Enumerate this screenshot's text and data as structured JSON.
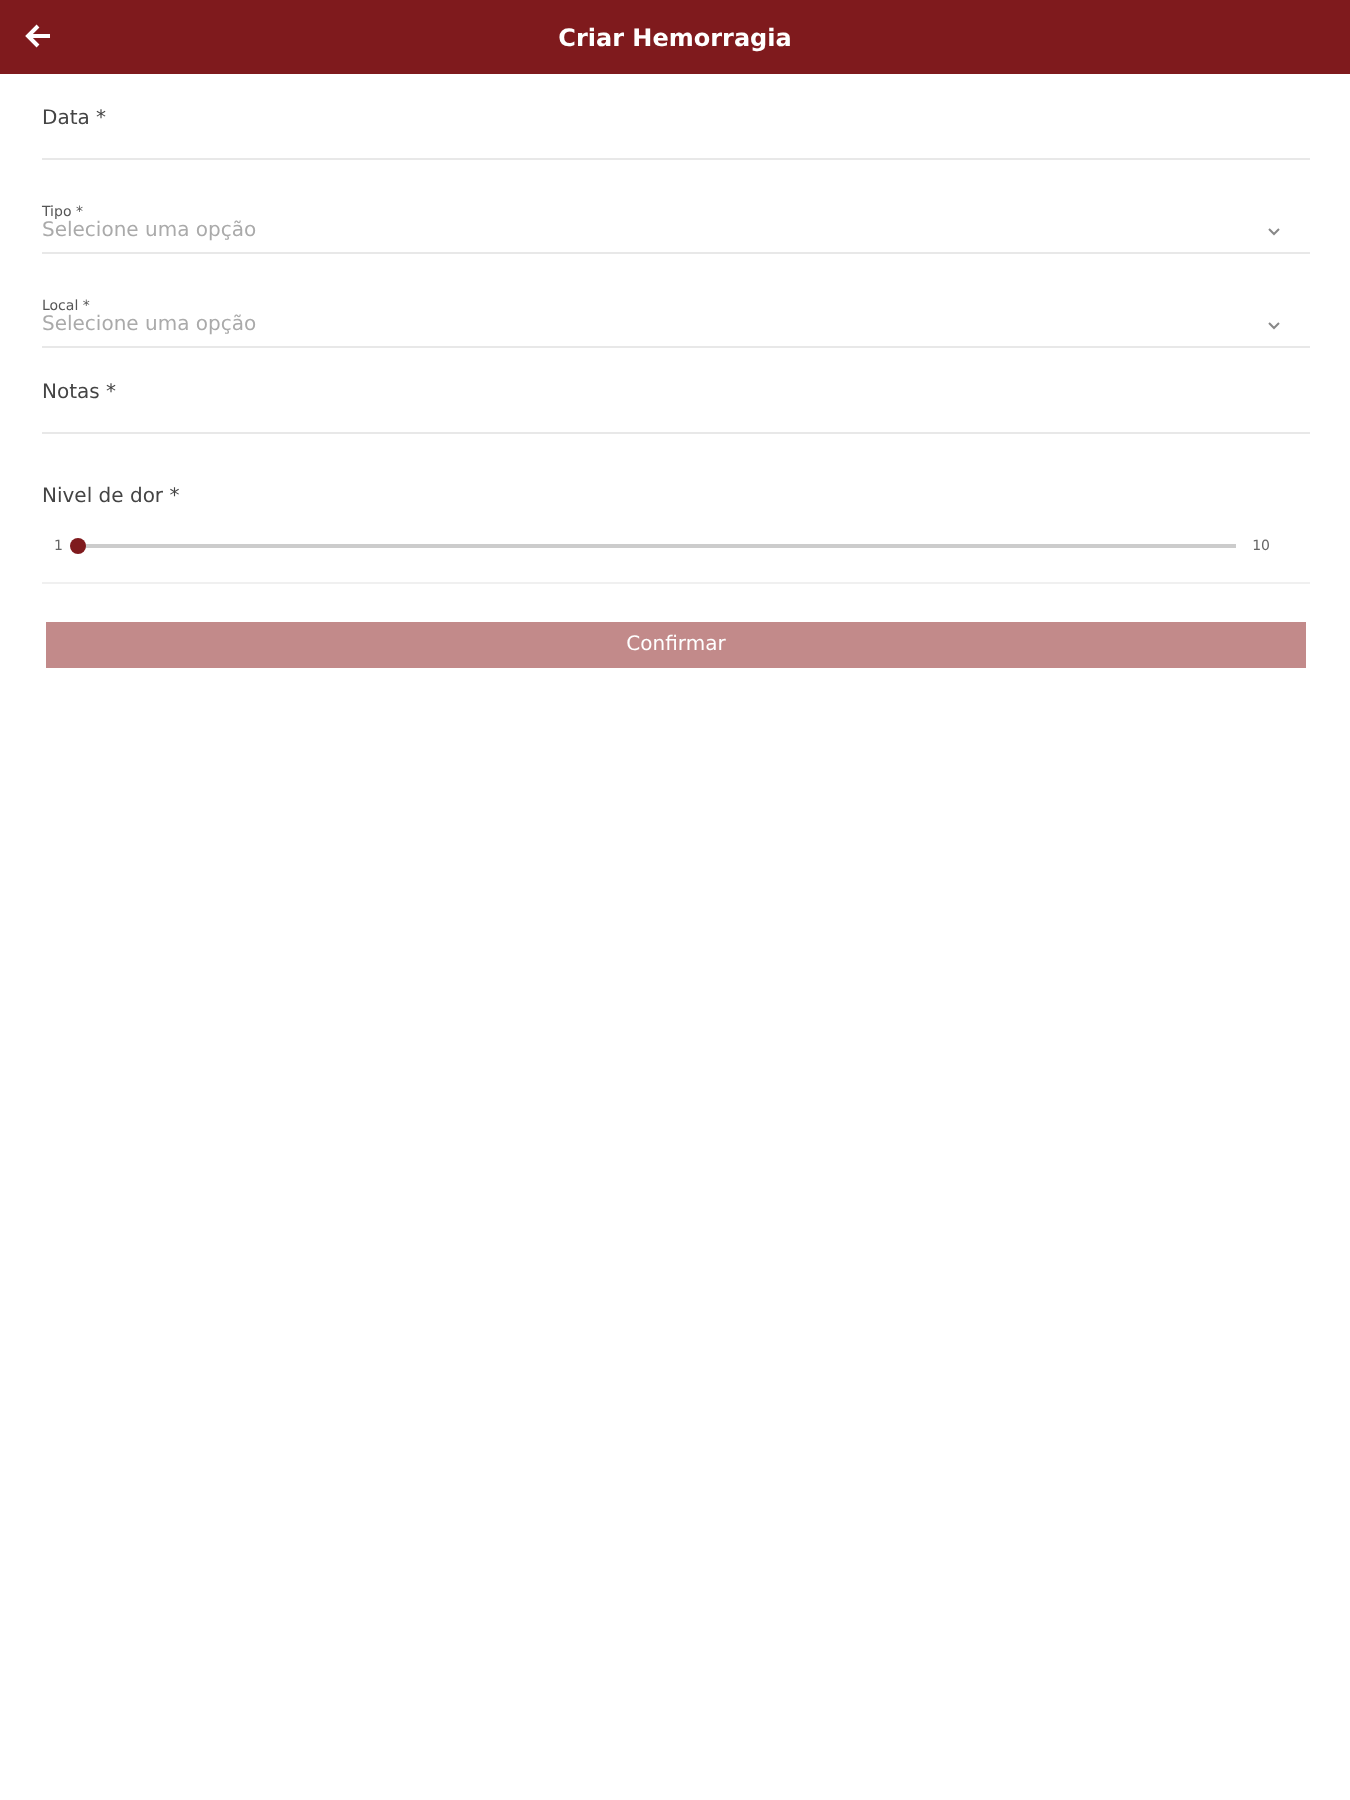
{
  "header": {
    "title": "Criar Hemorragia"
  },
  "fields": [
    {
      "kind": "text",
      "label": "Data *"
    },
    {
      "kind": "select",
      "label": "Tipo *",
      "placeholder": "Selecione uma opção"
    },
    {
      "kind": "select",
      "label": "Local *",
      "placeholder": "Selecione uma opção"
    },
    {
      "kind": "text",
      "label": "Notas *"
    }
  ],
  "pain": {
    "label": "Nivel de dor *",
    "min": "1",
    "max": "10",
    "level": 0
  },
  "confirm": {
    "label": "Confirmar",
    "disabled": true
  }
}
